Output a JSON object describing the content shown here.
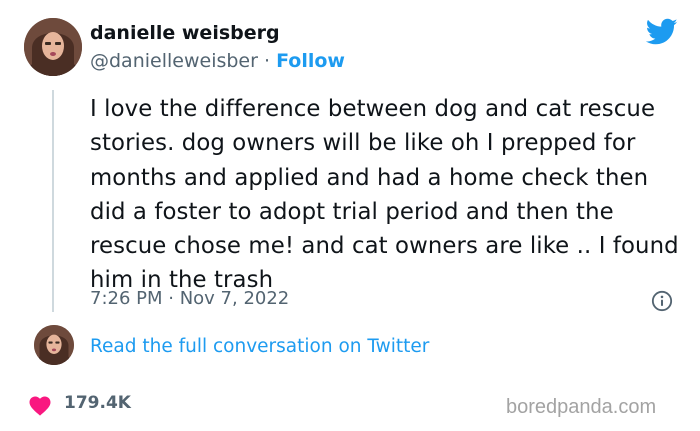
{
  "tweet": {
    "author_name": "danielle weisberg",
    "handle": "@danielleweisber",
    "separator": " · ",
    "follow_label": "Follow",
    "text": "I love the difference between dog and cat rescue stories. dog owners will be like oh I prepped for months and applied and had a home check then did a foster to adopt trial period and then the rescue chose me! and cat owners are like .. I found him in the trash",
    "time": "7:26 PM",
    "date": "Nov 7, 2022",
    "read_more": "Read the full conversation on Twitter",
    "likes": "179.4K"
  },
  "watermark": "boredpanda.com",
  "colors": {
    "twitter_blue": "#1d9bf0",
    "heart_red": "#f91880",
    "muted_text": "#536471"
  },
  "icons": [
    "twitter-bird-icon",
    "info-icon",
    "heart-icon"
  ]
}
